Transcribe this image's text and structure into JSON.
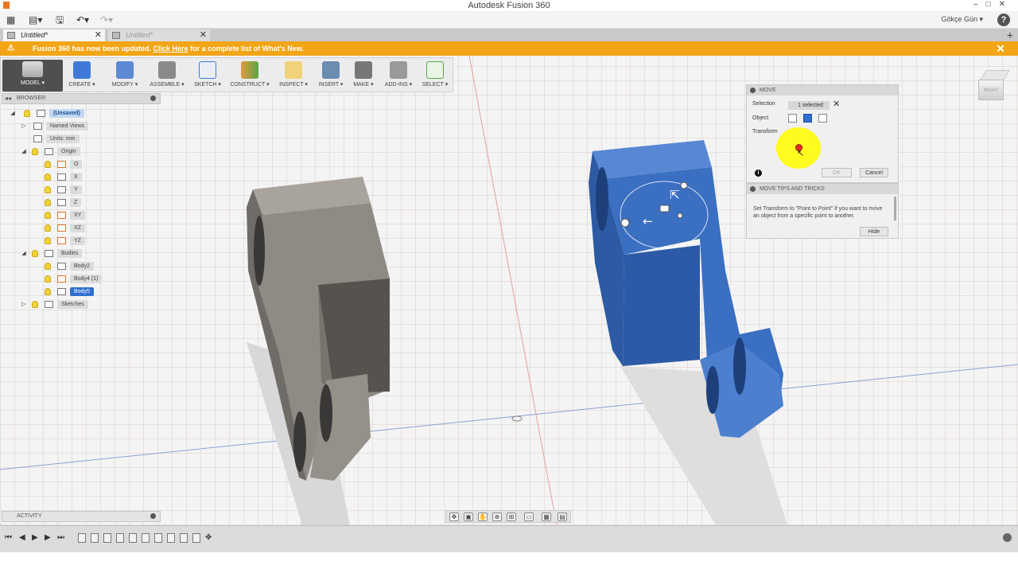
{
  "window": {
    "title": "Autodesk Fusion 360"
  },
  "qat": {
    "user": "Gökçe Gün ▾",
    "help": "?"
  },
  "tabs": [
    {
      "label": "Untitled*",
      "active": true
    },
    {
      "label": "Untitled*",
      "active": false
    }
  ],
  "notification": {
    "text_before": "Fusion 360 has now been updated.",
    "link": "Click Here",
    "text_after": "for a complete list of What's New.",
    "color": "#f2a516"
  },
  "toolbar": {
    "workspace": "MODEL ▾",
    "groups": [
      "CREATE ▾",
      "MODIFY ▾",
      "ASSEMBLE ▾",
      "SKETCH ▾",
      "CONSTRUCT ▾",
      "INSPECT ▾",
      "INSERT ▾",
      "MAKE ▾",
      "ADD-INS ▾",
      "SELECT ▾"
    ]
  },
  "browser": {
    "title": "BROWSER",
    "root": "(Unsaved)",
    "named_views": "Named Views",
    "units": "Units: mm",
    "origin": "Origin",
    "origin_items": [
      "O",
      "X",
      "Y",
      "Z",
      "XY",
      "XZ",
      "YZ"
    ],
    "bodies": "Bodies",
    "body_items": [
      "Body2",
      "Body4 (1)",
      "Body5"
    ],
    "sketches": "Sketches"
  },
  "move_panel": {
    "title": "MOVE",
    "selection_label": "Selection",
    "selection_value": "1 selected",
    "object_label": "Object",
    "transform_label": "Transform",
    "ok": "OK",
    "cancel": "Cancel"
  },
  "tips_panel": {
    "title": "MOVE TIPS AND TRICKS",
    "body": "Set Transform to \"Point to Point\" if you want to move an object from a specific point to another.",
    "hide": "Hide"
  },
  "viewcube": {
    "face": "RIGHT"
  },
  "activity": {
    "title": "ACTIVITY"
  },
  "colors": {
    "body_grey": "#8e8a84",
    "body_blue": "#3a6fc1",
    "accent": "#2e6fcf"
  }
}
